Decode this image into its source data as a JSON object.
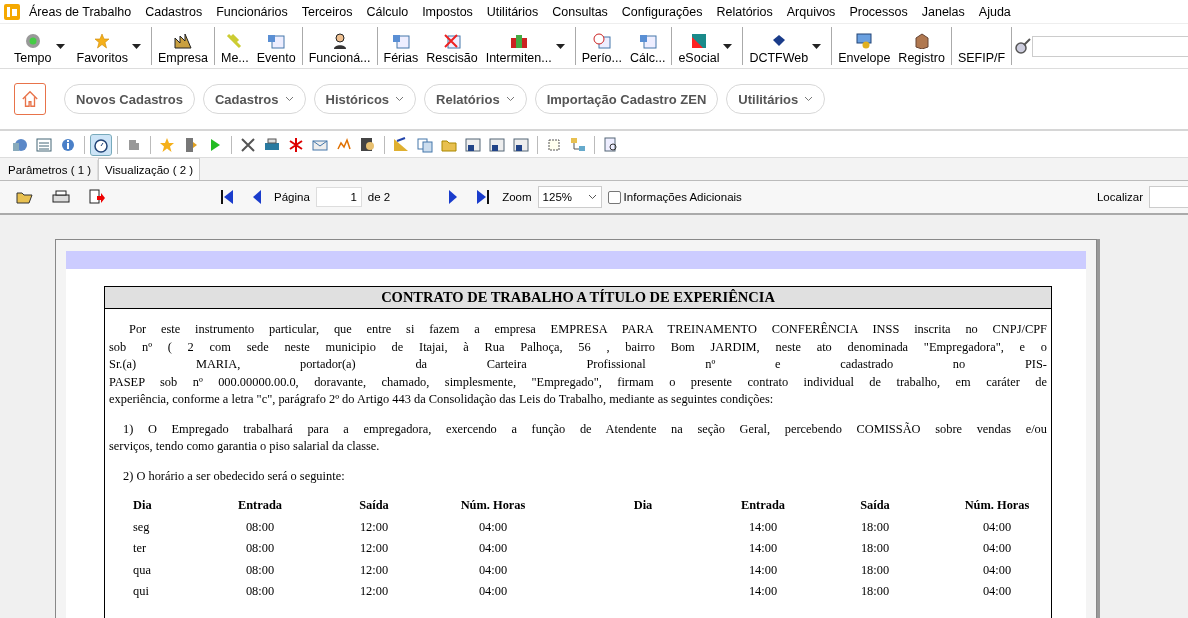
{
  "menu": [
    "Áreas de Trabalho",
    "Cadastros",
    "Funcionários",
    "Terceiros",
    "Cálculo",
    "Impostos",
    "Utilitários",
    "Consultas",
    "Configurações",
    "Relatórios",
    "Arquivos",
    "Processos",
    "Janelas",
    "Ajuda"
  ],
  "toolbar": [
    {
      "items": [
        {
          "label": "Tempo",
          "dropdown": true
        },
        {
          "label": "Favoritos",
          "dropdown": true
        }
      ]
    },
    {
      "items": [
        {
          "label": "Empresa",
          "dropdown": false
        }
      ]
    },
    {
      "items": [
        {
          "label": "Me...",
          "dropdown": false
        },
        {
          "label": "Evento",
          "dropdown": false
        }
      ]
    },
    {
      "items": [
        {
          "label": "Funcioná...",
          "dropdown": false
        }
      ]
    },
    {
      "items": [
        {
          "label": "Férias",
          "dropdown": false
        },
        {
          "label": "Rescisão",
          "dropdown": false
        },
        {
          "label": "Intermiten...",
          "dropdown": true
        }
      ]
    },
    {
      "items": [
        {
          "label": "Perío...",
          "dropdown": false
        },
        {
          "label": "Cálc...",
          "dropdown": false
        }
      ]
    },
    {
      "items": [
        {
          "label": "eSocial",
          "dropdown": true
        }
      ]
    },
    {
      "items": [
        {
          "label": "DCTFWeb",
          "dropdown": true
        }
      ]
    },
    {
      "items": [
        {
          "label": "Envelope",
          "dropdown": false
        },
        {
          "label": "Registro",
          "dropdown": false
        }
      ]
    },
    {
      "items": [
        {
          "label": "SEFIP/F",
          "dropdown": false
        }
      ]
    }
  ],
  "nav": [
    {
      "label": "Novos Cadastros",
      "dropdown": false
    },
    {
      "label": "Cadastros",
      "dropdown": true
    },
    {
      "label": "Históricos",
      "dropdown": true
    },
    {
      "label": "Relatórios",
      "dropdown": true
    },
    {
      "label": "Importação Cadastro ZEN",
      "dropdown": false
    },
    {
      "label": "Utilitários",
      "dropdown": true
    }
  ],
  "tabs": [
    {
      "label": "Parâmetros ( 1 )",
      "selected": false
    },
    {
      "label": "Visualização ( 2 )",
      "selected": true
    }
  ],
  "viewer": {
    "page_label": "Página",
    "page_value": "1",
    "page_total": "de 2",
    "zoom_label": "Zoom",
    "zoom_value": "125%",
    "additional_info": {
      "label": "Informações Adicionais",
      "checked": false
    },
    "find_label": "Localizar"
  },
  "document": {
    "title": "CONTRATO DE TRABALHO A TÍTULO DE EXPERIÊNCIA",
    "paragraphs": [
      {
        "lines": [
          "Por este instrumento particular, que entre si fazem a empresa EMPRESA PARA TREINAMENTO CONFERÊNCIA INSS inscrita no CNPJ/CPF",
          "sob nº ( 2 com sede neste municipio de Itajai, à Rua Palhoça, 56 , bairro Bom JARDIM, neste ato denominada \"Empregadora\", e o",
          "Sr.(a) MARIA, portador(a) da Carteira Profissional nº e cadastrado no PIS-",
          "PASEP sob nº 000.00000.00.0, doravante, chamado, simplesmente, \"Empregado\", firmam o presente contrato individual de trabalho, em caráter de",
          "experiência, conforme a letra \"c\", parágrafo 2º do Artigo 443 da Consolidação das Leis do Trabalho, mediante as seguintes condições:"
        ]
      },
      {
        "lines": [
          "1) O Empregado trabalhará para a empregadora, exercendo a função de Atendente na seção Geral, percebendo COMISSÃO sobre vendas e/ou",
          "serviços, tendo como garantia o piso salarial da classe."
        ]
      },
      {
        "lines": [
          "2) O horário a ser obedecido será o seguinte:"
        ]
      }
    ],
    "schedule": {
      "columns": [
        "Dia",
        "Entrada",
        "Saída",
        "Núm. Horas",
        "Dia",
        "Entrada",
        "Saída",
        "Núm. Horas"
      ],
      "rows": [
        [
          "seg",
          "08:00",
          "12:00",
          "04:00",
          "",
          "14:00",
          "18:00",
          "04:00"
        ],
        [
          "ter",
          "08:00",
          "12:00",
          "04:00",
          "",
          "14:00",
          "18:00",
          "04:00"
        ],
        [
          "qua",
          "08:00",
          "12:00",
          "04:00",
          "",
          "14:00",
          "18:00",
          "04:00"
        ],
        [
          "qui",
          "08:00",
          "12:00",
          "04:00",
          "",
          "14:00",
          "18:00",
          "04:00"
        ]
      ]
    }
  }
}
